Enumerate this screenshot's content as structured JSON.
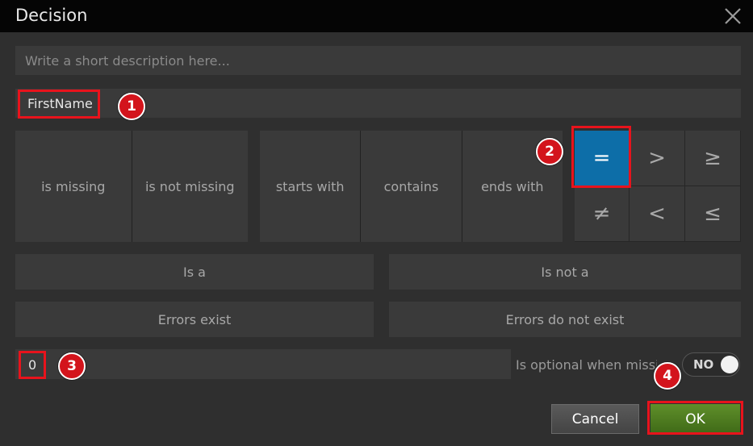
{
  "window": {
    "title": "Decision"
  },
  "description": {
    "placeholder": "Write a short description here..."
  },
  "field": {
    "name": "FirstName"
  },
  "badges": [
    "1",
    "2",
    "3",
    "4"
  ],
  "presence_ops": [
    "is missing",
    "is not missing"
  ],
  "string_ops": [
    "starts with",
    "contains",
    "ends with"
  ],
  "comparison_ops": [
    {
      "symbol": "=",
      "selected": true
    },
    {
      "symbol": ">",
      "selected": false
    },
    {
      "symbol": "≥",
      "selected": false
    },
    {
      "symbol": "≠",
      "selected": false
    },
    {
      "symbol": "<",
      "selected": false
    },
    {
      "symbol": "≤",
      "selected": false
    }
  ],
  "type_ops": [
    "Is a",
    "Is not a"
  ],
  "error_ops": [
    "Errors exist",
    "Errors do not exist"
  ],
  "value": {
    "text": "0"
  },
  "optional": {
    "label": "Is optional when missing",
    "toggle": "NO"
  },
  "buttons": {
    "cancel": "Cancel",
    "ok": "OK"
  },
  "colors": {
    "accent_selected": "#0d6ea8",
    "ok_green": "#4f7d21",
    "highlight_red": "#e8131c"
  }
}
